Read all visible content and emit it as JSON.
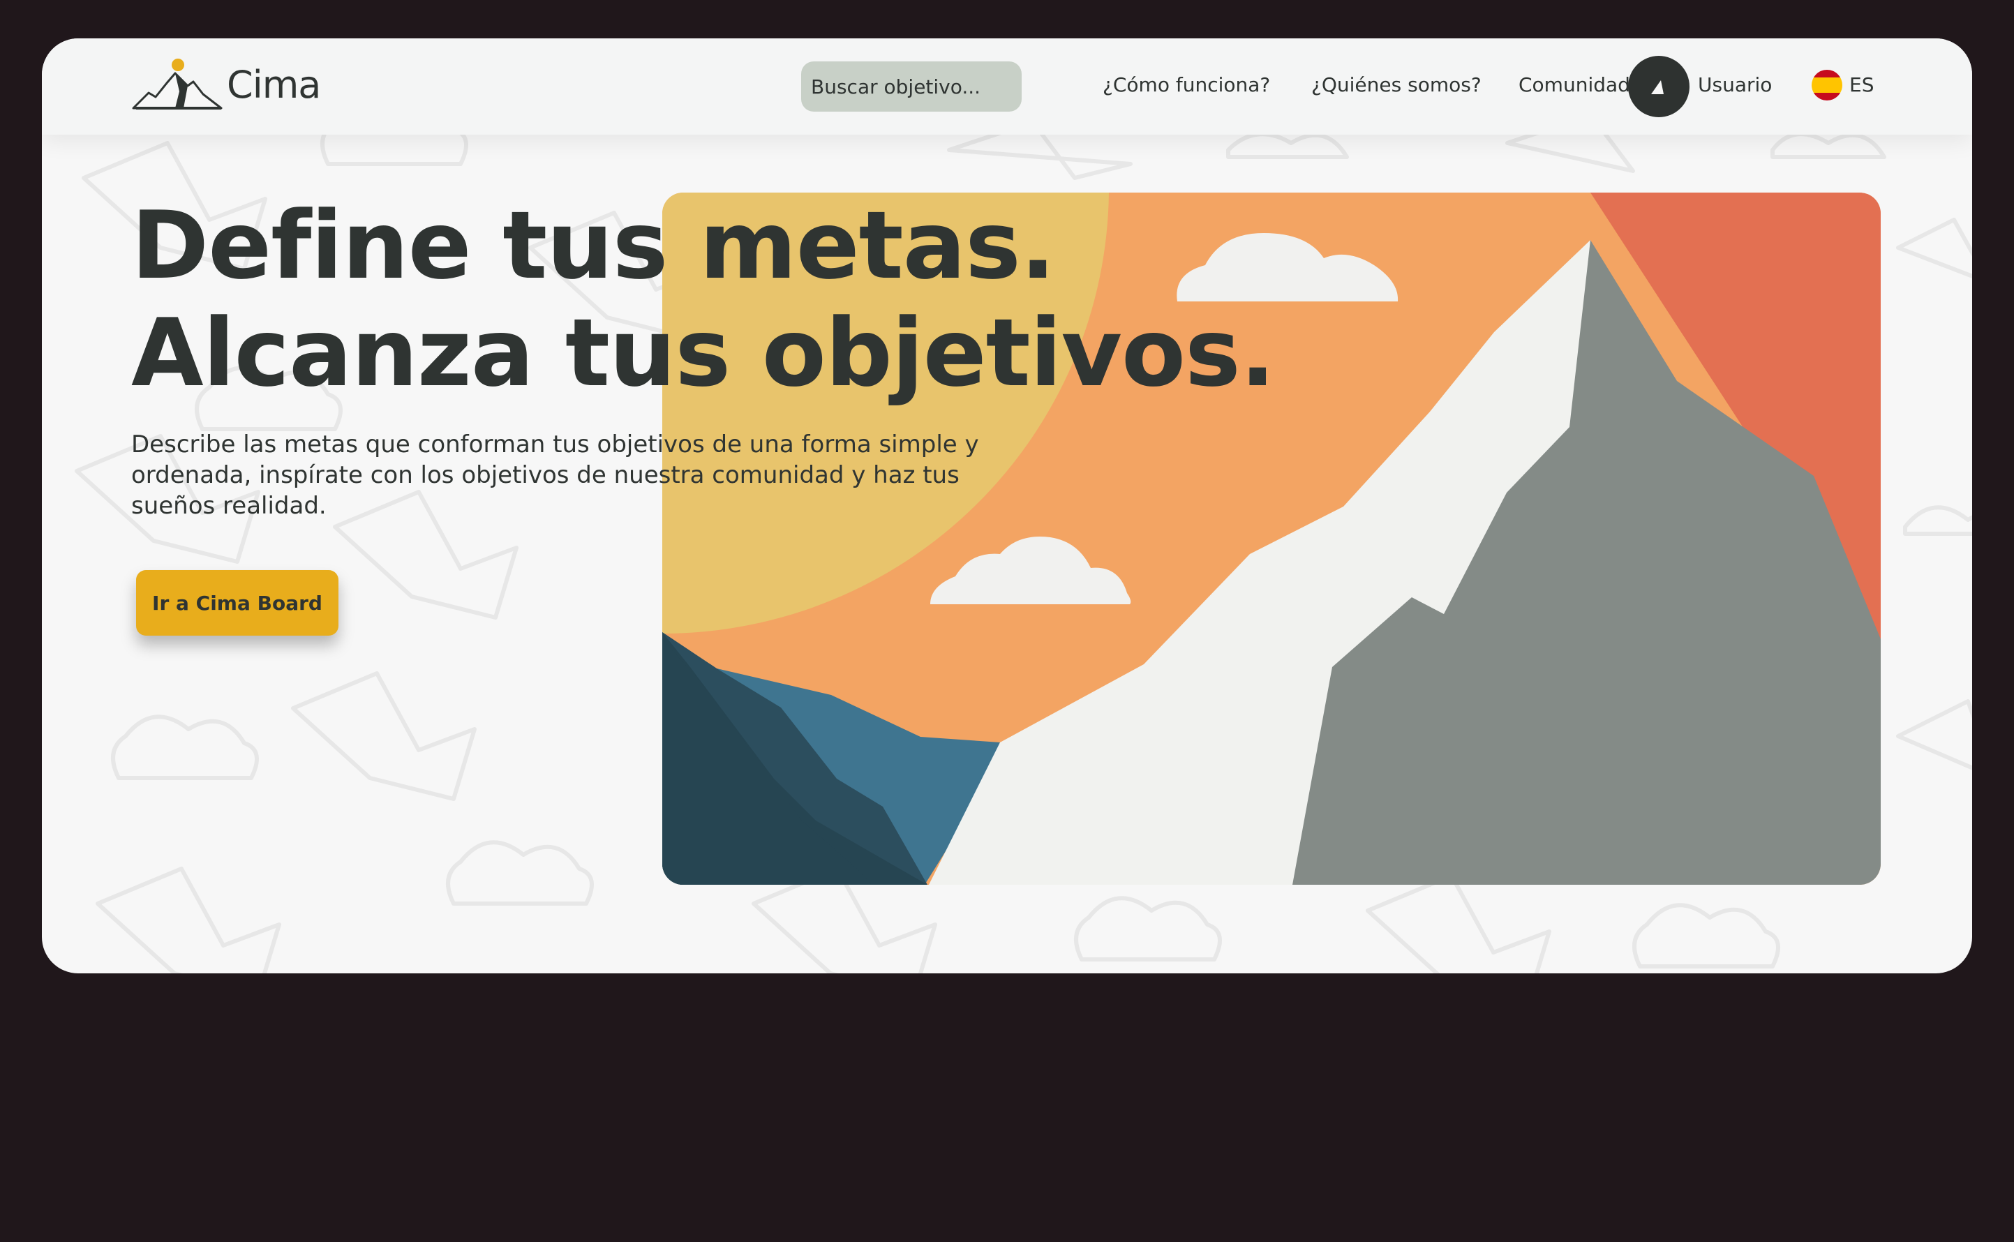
{
  "brand": {
    "name": "Cima",
    "logo_icon": "mountain-sun-icon"
  },
  "search": {
    "placeholder": "Buscar objetivo..."
  },
  "nav": {
    "links": [
      "¿Cómo funciona?",
      "¿Quiénes somos?",
      "Comunidad"
    ],
    "user_label": "Usuario",
    "user_icon": "user-mountain-icon",
    "language": "ES",
    "language_icon": "spain-flag-icon"
  },
  "hero": {
    "headline_line1": "Define tus metas.",
    "headline_line2": "Alcanza tus objetivos.",
    "description": "Describe las metas que conforman tus objetivos de una forma simple y ordenada, inspírate con los objetivos de nuestra comunidad y haz tus sueños realidad.",
    "cta_label": "Ir a Cima Board",
    "illustration": "mountain-landscape-illustration"
  },
  "colors": {
    "page_bg": "#20171b",
    "surface": "#f7f7f7",
    "text": "#2f3432",
    "accent": "#e8ad1c",
    "search_bg": "#c8d0c7",
    "sun": "#e8c46c",
    "sky": "#f3a463",
    "sunset_red": "#e37052",
    "rock": "#848b87"
  }
}
